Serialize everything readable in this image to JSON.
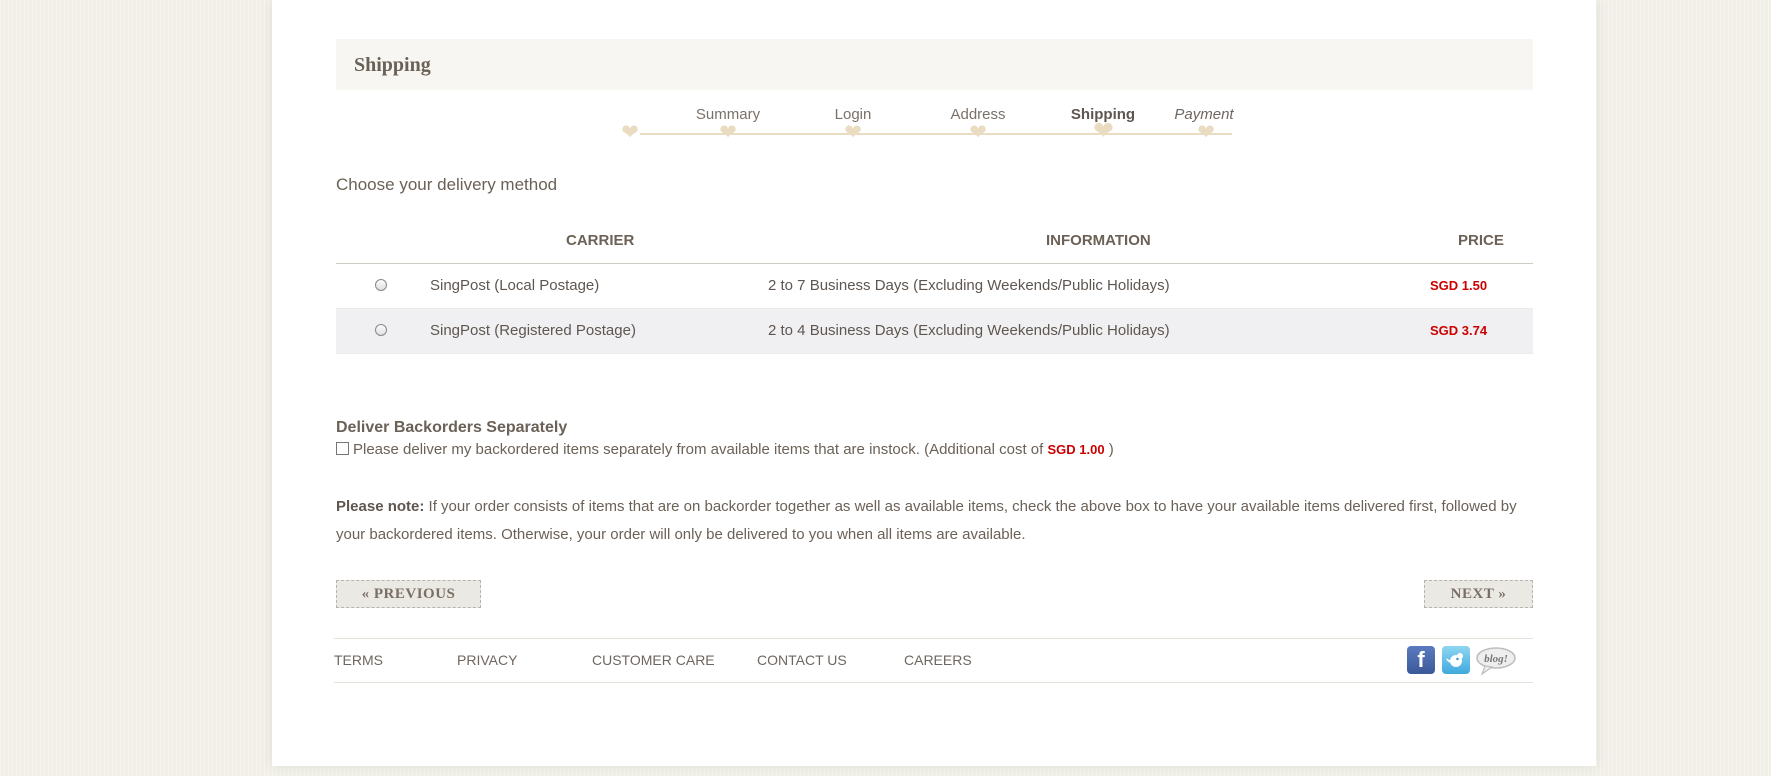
{
  "section_title": "Shipping",
  "steps": [
    {
      "label": "Summary",
      "state": "done"
    },
    {
      "label": "Login",
      "state": "done"
    },
    {
      "label": "Address",
      "state": "done"
    },
    {
      "label": "Shipping",
      "state": "current"
    },
    {
      "label": "Payment",
      "state": "next"
    }
  ],
  "delivery": {
    "title": "Choose your delivery method",
    "headers": {
      "carrier": "CARRIER",
      "information": "INFORMATION",
      "price": "PRICE"
    },
    "rows": [
      {
        "carrier": "SingPost (Local Postage)",
        "information": "2 to 7 Business Days (Excluding Weekends/Public Holidays)",
        "price": "SGD 1.50"
      },
      {
        "carrier": "SingPost (Registered Postage)",
        "information": "2 to 4 Business Days (Excluding Weekends/Public Holidays)",
        "price": "SGD 3.74"
      }
    ]
  },
  "backorders": {
    "title": "Deliver Backorders Separately",
    "checkbox_text": "Please deliver my backordered items separately from available items that are instock. (Additional cost of",
    "cost": "SGD 1.00",
    "closing": ")"
  },
  "note": {
    "label": "Please note:",
    "text": "If your order consists of items that are on backorder together as well as available items, check the above box to have your available items delivered first, followed by your backordered items. Otherwise, your order will only be delivered to you when all items are available."
  },
  "buttons": {
    "previous": "« PREVIOUS",
    "next": "NEXT »"
  },
  "footer": {
    "links": [
      "TERMS",
      "PRIVACY",
      "CUSTOMER CARE",
      "CONTACT US",
      "CAREERS"
    ],
    "social": {
      "facebook": "f",
      "blog": "blog!"
    }
  },
  "colors": {
    "accent_price": "#cc0000",
    "step_heart": "#eadcc0",
    "text": "#6b6157"
  },
  "icons": [
    "heart-icon",
    "facebook-icon",
    "twitter-icon",
    "blog-icon"
  ]
}
